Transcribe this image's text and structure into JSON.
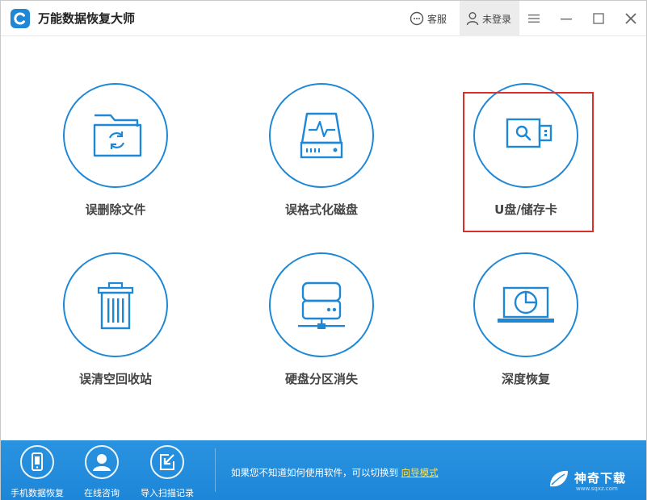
{
  "app": {
    "title": "万能数据恢复大师",
    "accent_color": "#1e88d6",
    "highlight_color": "#d9302c"
  },
  "titlebar": {
    "feedback_label": "客服",
    "login_label": "未登录",
    "icons": [
      "chat-icon",
      "user-icon",
      "menu-icon",
      "minimize-icon",
      "maximize-icon",
      "close-icon"
    ]
  },
  "tiles": [
    {
      "label": "误删除文件",
      "icon": "folder-recover-icon"
    },
    {
      "label": "误格式化磁盘",
      "icon": "disk-pulse-icon"
    },
    {
      "label": "U盘/储存卡",
      "icon": "usb-drive-icon",
      "highlighted": true
    },
    {
      "label": "误清空回收站",
      "icon": "trash-icon"
    },
    {
      "label": "硬盘分区消失",
      "icon": "network-drive-icon"
    },
    {
      "label": "深度恢复",
      "icon": "laptop-scan-icon"
    }
  ],
  "bottombar": {
    "items": [
      {
        "label": "手机数据恢复",
        "icon": "phone-icon"
      },
      {
        "label": "在线咨询",
        "icon": "person-icon"
      },
      {
        "label": "导入扫描记录",
        "icon": "import-icon"
      }
    ],
    "hint_text": "如果您不知道如何使用软件，可以切换到",
    "hint_link": "向导模式",
    "watermark_text": "神奇下载",
    "watermark_sub": "www.sqxz.com"
  }
}
